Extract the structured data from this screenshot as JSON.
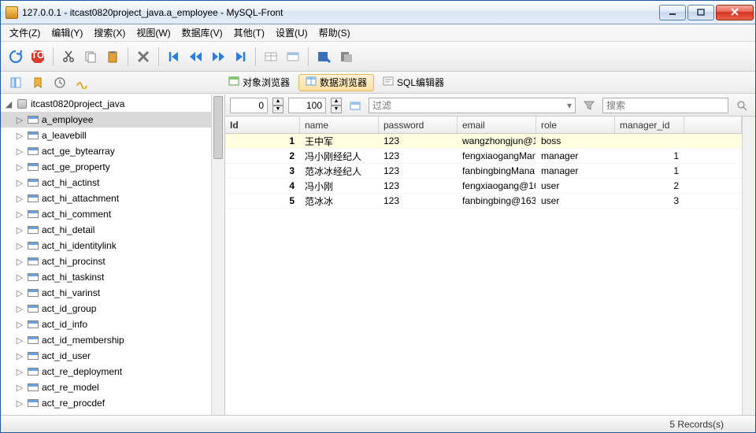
{
  "window": {
    "title": "127.0.0.1 - itcast0820project_java.a_employee - MySQL-Front"
  },
  "menu": {
    "file": "文件(Z)",
    "edit": "编辑(Y)",
    "search": "搜索(X)",
    "view": "视图(W)",
    "database": "数据库(V)",
    "other": "其他(T)",
    "settings": "设置(U)",
    "help": "帮助(S)"
  },
  "tabs": {
    "object_browser": "对象浏览器",
    "data_browser": "数据浏览器",
    "sql_editor": "SQL编辑器"
  },
  "filter": {
    "offset": "0",
    "limit": "100",
    "filter_label": "过滤",
    "search_placeholder": "搜索"
  },
  "tree": {
    "root": "itcast0820project_java",
    "items": [
      "a_employee",
      "a_leavebill",
      "act_ge_bytearray",
      "act_ge_property",
      "act_hi_actinst",
      "act_hi_attachment",
      "act_hi_comment",
      "act_hi_detail",
      "act_hi_identitylink",
      "act_hi_procinst",
      "act_hi_taskinst",
      "act_hi_varinst",
      "act_id_group",
      "act_id_info",
      "act_id_membership",
      "act_id_user",
      "act_re_deployment",
      "act_re_model",
      "act_re_procdef"
    ],
    "selected_index": 0
  },
  "grid": {
    "headers": {
      "id": "Id",
      "name": "name",
      "password": "password",
      "email": "email",
      "role": "role",
      "manager_id": "manager_id"
    },
    "rows": [
      {
        "id": "1",
        "name": "王中军",
        "password": "123",
        "email": "wangzhongjun@1",
        "role": "boss",
        "manager_id": "<NULL>",
        "null_mgr": true
      },
      {
        "id": "2",
        "name": "冯小刚经纪人",
        "password": "123",
        "email": "fengxiaogangMan",
        "role": "manager",
        "manager_id": "1"
      },
      {
        "id": "3",
        "name": "范冰冰经纪人",
        "password": "123",
        "email": "fanbingbingMana",
        "role": "manager",
        "manager_id": "1"
      },
      {
        "id": "4",
        "name": "冯小刚",
        "password": "123",
        "email": "fengxiaogang@16",
        "role": "user",
        "manager_id": "2"
      },
      {
        "id": "5",
        "name": "范冰冰",
        "password": "123",
        "email": "fanbingbing@163",
        "role": "user",
        "manager_id": "3"
      }
    ]
  },
  "status": {
    "records": "5 Records(s)"
  }
}
